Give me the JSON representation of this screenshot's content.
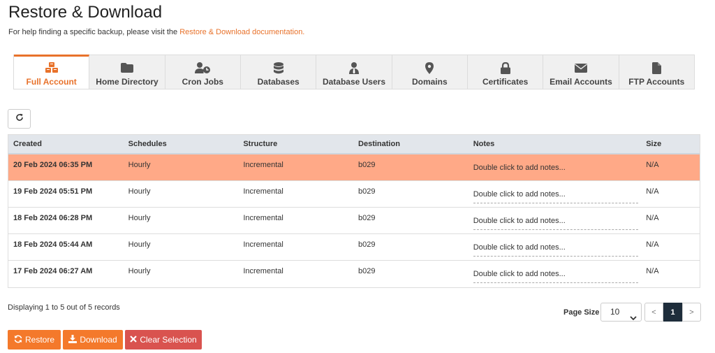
{
  "page": {
    "title": "Restore & Download",
    "help_prefix": "For help finding a specific backup, please visit the ",
    "help_link": "Restore & Download documentation."
  },
  "tabs": [
    {
      "label": "Full Account",
      "icon": "cubes-icon",
      "active": true
    },
    {
      "label": "Home Directory",
      "icon": "folder-icon"
    },
    {
      "label": "Cron Jobs",
      "icon": "user-clock-icon"
    },
    {
      "label": "Databases",
      "icon": "database-icon"
    },
    {
      "label": "Database Users",
      "icon": "user-tie-icon"
    },
    {
      "label": "Domains",
      "icon": "map-marker-icon"
    },
    {
      "label": "Certificates",
      "icon": "lock-icon"
    },
    {
      "label": "Email Accounts",
      "icon": "envelope-icon"
    },
    {
      "label": "FTP Accounts",
      "icon": "file-icon"
    }
  ],
  "table": {
    "headers": [
      "Created",
      "Schedules",
      "Structure",
      "Destination",
      "Notes",
      "Size"
    ],
    "rows": [
      {
        "created": "20 Feb 2024 06:35 PM",
        "schedule": "Hourly",
        "structure": "Incremental",
        "destination": "b029",
        "notes": "Double click to add notes...",
        "size": "N/A",
        "selected": true
      },
      {
        "created": "19 Feb 2024 05:51 PM",
        "schedule": "Hourly",
        "structure": "Incremental",
        "destination": "b029",
        "notes": "Double click to add notes...",
        "size": "N/A"
      },
      {
        "created": "18 Feb 2024 06:28 PM",
        "schedule": "Hourly",
        "structure": "Incremental",
        "destination": "b029",
        "notes": "Double click to add notes...",
        "size": "N/A"
      },
      {
        "created": "18 Feb 2024 05:44 AM",
        "schedule": "Hourly",
        "structure": "Incremental",
        "destination": "b029",
        "notes": "Double click to add notes...",
        "size": "N/A"
      },
      {
        "created": "17 Feb 2024 06:27 AM",
        "schedule": "Hourly",
        "structure": "Incremental",
        "destination": "b029",
        "notes": "Double click to add notes...",
        "size": "N/A"
      }
    ]
  },
  "footer": {
    "records_text": "Displaying 1 to 5 out of 5 records",
    "page_size_label": "Page Size",
    "page_size_value": "10",
    "pager": {
      "prev": "<",
      "current": "1",
      "next": ">"
    }
  },
  "actions": {
    "restore": "Restore",
    "download": "Download",
    "clear": "Clear Selection"
  },
  "colors": {
    "accent": "#f4792b",
    "selected_row": "#ffa987",
    "danger": "#d9534f",
    "pager_active": "#1e2d3b"
  }
}
